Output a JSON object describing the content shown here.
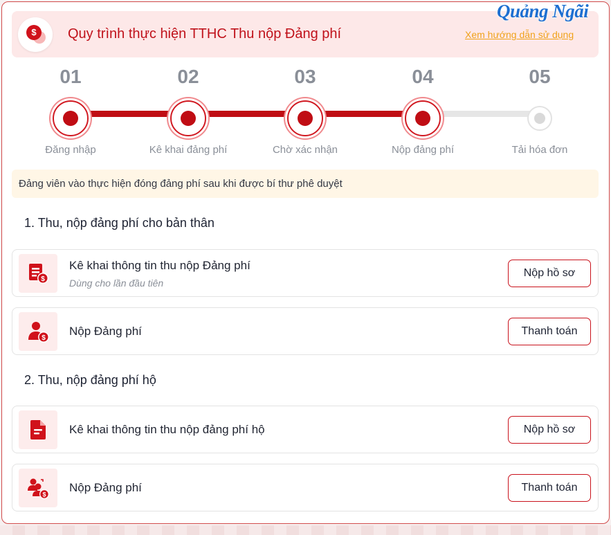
{
  "header": {
    "title": "Quy trình thực hiện TTHC Thu nộp Đảng phí",
    "guide_link": "Xem hướng dẫn sử dụng",
    "watermark": "Quảng Ngãi",
    "badge_symbol": "$"
  },
  "stepper": {
    "current_step": 4,
    "steps": [
      {
        "number": "01",
        "label": "Đăng nhập",
        "status": "done"
      },
      {
        "number": "02",
        "label": "Kê khai đảng phí",
        "status": "done"
      },
      {
        "number": "03",
        "label": "Chờ xác nhận",
        "status": "done"
      },
      {
        "number": "04",
        "label": "Nộp đảng phí",
        "status": "done"
      },
      {
        "number": "05",
        "label": "Tải hóa đơn",
        "status": "pending"
      }
    ]
  },
  "notice": "Đảng viên vào thực hiện đóng đảng phí sau khi được bí thư phê duyệt",
  "sections": [
    {
      "title": "1. Thu, nộp đảng phí cho bản thân",
      "items": [
        {
          "icon": "document-money-icon",
          "title": "Kê khai thông tin thu nộp Đảng phí",
          "subtitle": "Dùng cho lần đầu tiên",
          "button": "Nộp hồ sơ"
        },
        {
          "icon": "user-money-icon",
          "title": "Nộp Đảng phí",
          "button": "Thanh toán"
        }
      ]
    },
    {
      "title": "2. Thu, nộp đảng phí hộ",
      "items": [
        {
          "icon": "file-icon",
          "title": "Kê khai thông tin thu nộp đảng phí hộ",
          "button": "Nộp hồ sơ"
        },
        {
          "icon": "users-money-icon",
          "title": "Nộp Đảng phí",
          "button": "Thanh toán"
        }
      ]
    }
  ],
  "colors": {
    "primary": "#c00d14",
    "header_bg": "#fde8e8",
    "notice_bg": "#fff6e6",
    "link": "#f0a21a",
    "step_text": "#8a8f98"
  }
}
